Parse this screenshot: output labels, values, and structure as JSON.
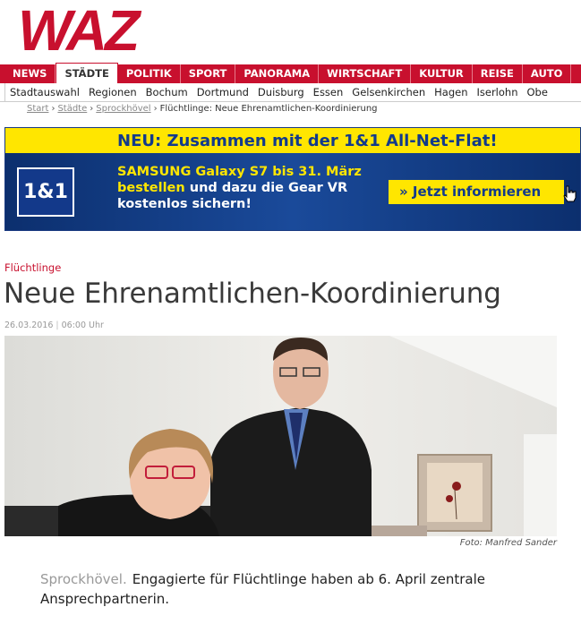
{
  "logo": {
    "text": "WAZ",
    "color": "#c8102e"
  },
  "main_nav": [
    {
      "label": "News",
      "active": false
    },
    {
      "label": "Städte",
      "active": true
    },
    {
      "label": "Politik",
      "active": false
    },
    {
      "label": "Sport",
      "active": false
    },
    {
      "label": "Panorama",
      "active": false
    },
    {
      "label": "Wirtschaft",
      "active": false
    },
    {
      "label": "Kultur",
      "active": false
    },
    {
      "label": "Reise",
      "active": false
    },
    {
      "label": "Auto",
      "active": false
    }
  ],
  "sub_nav": [
    "Stadtauswahl",
    "Regionen",
    "Bochum",
    "Dortmund",
    "Duisburg",
    "Essen",
    "Gelsenkirchen",
    "Hagen",
    "Iserlohn",
    "Obe"
  ],
  "breadcrumb": {
    "links": [
      "Start",
      "Städte",
      "Sprockhövel"
    ],
    "current": "Flüchtlinge: Neue Ehrenamtlichen-Koordinierung",
    "separator": "›"
  },
  "ad": {
    "headline": "NEU:  Zusammen mit der 1&1 All-Net-Flat!",
    "logo_text": "1&1",
    "line1": "SAMSUNG Galaxy S7 bis 31. März",
    "line2_highlight": "bestellen",
    "line2_rest": " und dazu die Gear VR",
    "line3": "kostenlos sichern!",
    "cta_label": "» Jetzt informieren",
    "cursor_icon": "hand-pointer-icon"
  },
  "article": {
    "kicker": "Flüchtlinge",
    "headline": "Neue Ehrenamtlichen-Koordinierung",
    "date": "26.03.2016",
    "time": "06:00 Uhr",
    "photo_credit": "Foto: Manfred Sander",
    "teaser_place": "Sprockhövel.",
    "teaser_text": "Engagierte für Flüchtlinge haben ab 6. April zentrale Ansprechpartnerin."
  },
  "colors": {
    "brand_red": "#c8102e",
    "ad_blue": "#0f3577",
    "ad_yellow": "#ffe600"
  }
}
